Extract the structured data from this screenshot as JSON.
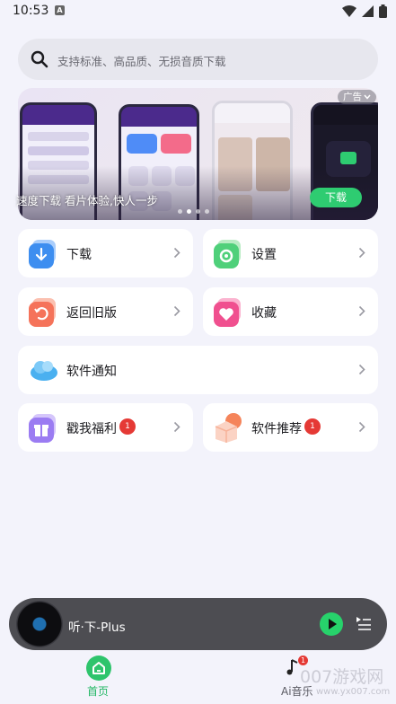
{
  "status_bar": {
    "time": "10:53",
    "notif_letter": "A"
  },
  "search": {
    "placeholder": "支持标准、高品质、无损音质下载"
  },
  "banner": {
    "ad_label": "广告",
    "caption": "速度下载 看片体验,快人一步",
    "download_label": "下载",
    "dots": 4,
    "active_dot": 1
  },
  "menu": {
    "download": "下载",
    "settings": "设置",
    "old_version": "返回旧版",
    "favorites": "收藏",
    "notification": "软件通知",
    "welfare": "戳我福利",
    "welfare_badge": "1",
    "recommend": "软件推荐",
    "recommend_badge": "1"
  },
  "player": {
    "title": "听·下-Plus"
  },
  "nav": {
    "home_label": "首页",
    "music_label": "Ai音乐",
    "music_badge": "1"
  },
  "watermark": {
    "main": "007游戏网",
    "url": "www.yx007.com"
  },
  "colors": {
    "accent_green": "#2ec46c",
    "badge_red": "#e53935",
    "player_bg": "#4d4d52"
  }
}
